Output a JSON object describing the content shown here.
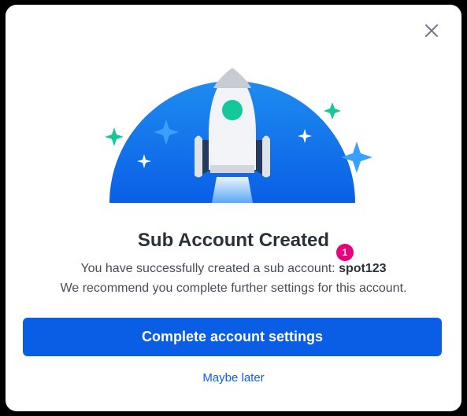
{
  "dialog": {
    "title": "Sub Account Created",
    "line1_prefix": "You have successfully created a sub account: ",
    "account_name": "spot123",
    "line2": "We recommend you complete further settings for this account.",
    "badge": "1",
    "primary_button": "Complete account settings",
    "secondary_link": "Maybe later",
    "close_icon": "close-icon",
    "illustration": "rocket-launch-illustration"
  },
  "colors": {
    "accent": "#0a5ee6",
    "badge": "#e6007e",
    "sparkle_green": "#16c79a",
    "sparkle_blue": "#3aa0ff"
  }
}
